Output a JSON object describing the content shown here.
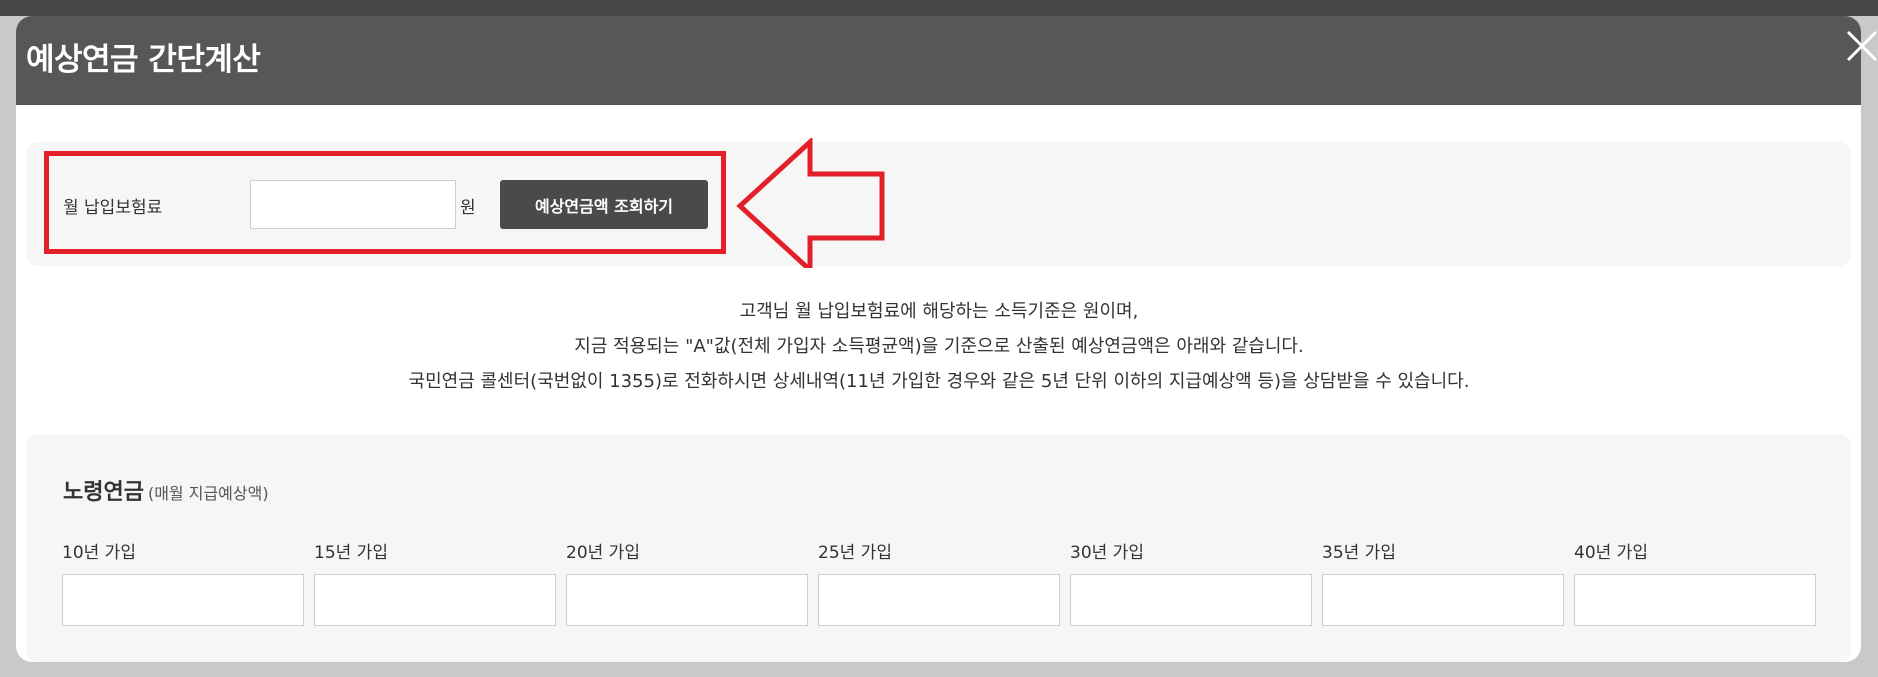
{
  "modal": {
    "title": "예상연금 간단계산",
    "close_icon": "close-icon"
  },
  "calculator": {
    "label": "월 납입보험료",
    "input_value": "",
    "unit": "원",
    "button_label": "예상연금액 조회하기"
  },
  "annotation": {
    "color": "#e3202a"
  },
  "notice": {
    "lines": [
      "고객님 월 납입보험료에 해당하는 소득기준은 원이며,",
      "지금 적용되는 \"A\"값(전체 가입자 소득평균액)을 기준으로 산출된 예상연금액은 아래와 같습니다.",
      "국민연금 콜센터(국번없이 1355)로 전화하시면 상세내역(11년 가입한 경우와 같은 5년 단위 이하의 지급예상액 등)을 상담받을 수 있습니다."
    ]
  },
  "pension": {
    "title": "노령연금",
    "subtitle": "(매월 지급예상액)",
    "periods": [
      {
        "label": "10년 가입",
        "value": ""
      },
      {
        "label": "15년 가입",
        "value": ""
      },
      {
        "label": "20년 가입",
        "value": ""
      },
      {
        "label": "25년 가입",
        "value": ""
      },
      {
        "label": "30년 가입",
        "value": ""
      },
      {
        "label": "35년 가입",
        "value": ""
      },
      {
        "label": "40년 가입",
        "value": ""
      }
    ]
  }
}
